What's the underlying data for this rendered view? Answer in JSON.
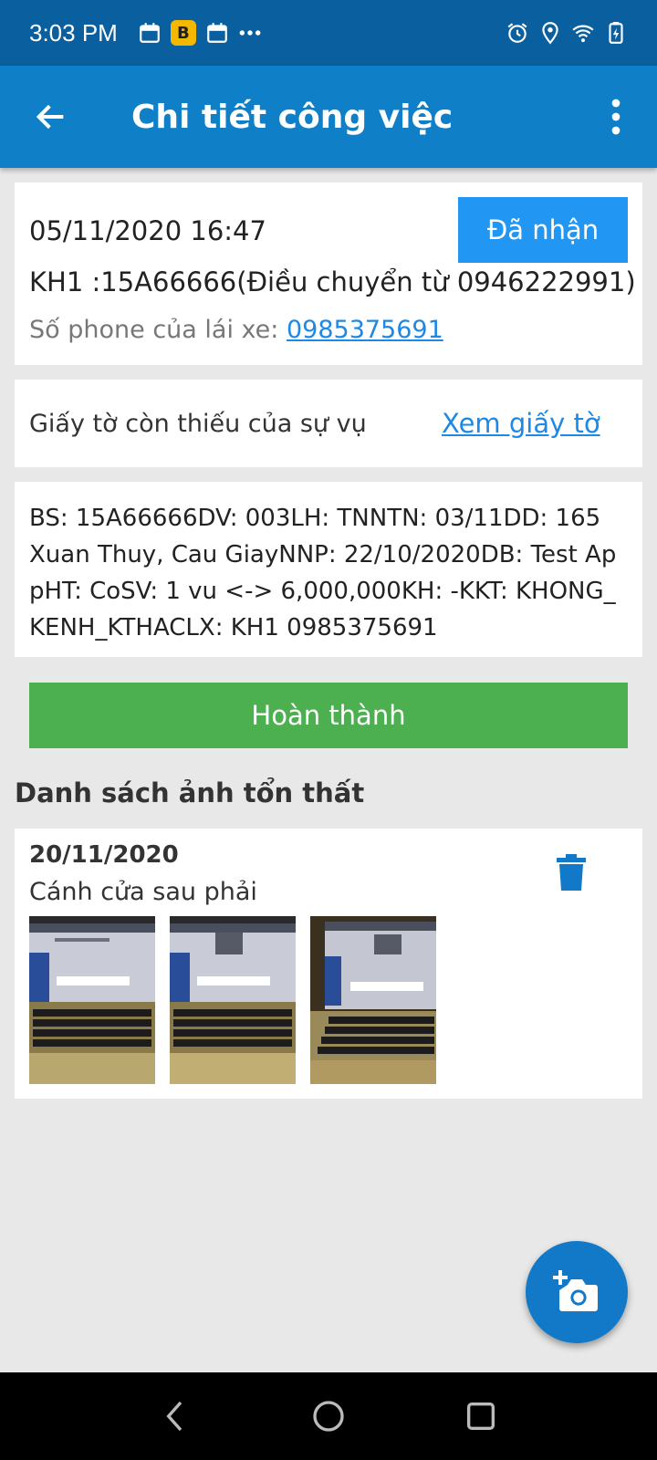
{
  "status_bar": {
    "time": "3:03 PM",
    "left_icons": [
      "calendar-icon",
      "app-notification-icon",
      "calendar-icon",
      "more-dots-icon"
    ],
    "right_icons": [
      "alarm-icon",
      "location-icon",
      "wifi-icon",
      "battery-charging-icon"
    ],
    "app_badge_letter": "B"
  },
  "app_bar": {
    "title": "Chi tiết công việc",
    "background": "#0f7fc8"
  },
  "job": {
    "datetime": "05/11/2020 16:47",
    "status_label": "Đã nhận",
    "vehicle_line": "KH1 :15A66666(Điều chuyển từ 0946222991)",
    "driver_phone_label": "Số phone của lái xe: ",
    "driver_phone": "0985375691"
  },
  "documents": {
    "missing_label": "Giấy tờ còn thiếu của sự vụ",
    "view_link": "Xem giấy tờ"
  },
  "info": {
    "text": "BS: 15A66666DV: 003LH: TNNTN: 03/11DD: 165 Xuan Thuy, Cau GiayNNP: 22/10/2020DB: Test AppHT: CoSV: 1 vu <-> 6,000,000KH: -KKT: KHONG_KENH_KTHACLX: KH1  0985375691"
  },
  "actions": {
    "complete_label": "Hoàn thành",
    "complete_color": "#4caf50",
    "status_color": "#2196f3"
  },
  "damage_photos": {
    "section_title": "Danh sách ảnh tổn thất",
    "items": [
      {
        "date": "20/11/2020",
        "part": "Cánh cửa sau phải",
        "photo_count": 3
      }
    ]
  }
}
